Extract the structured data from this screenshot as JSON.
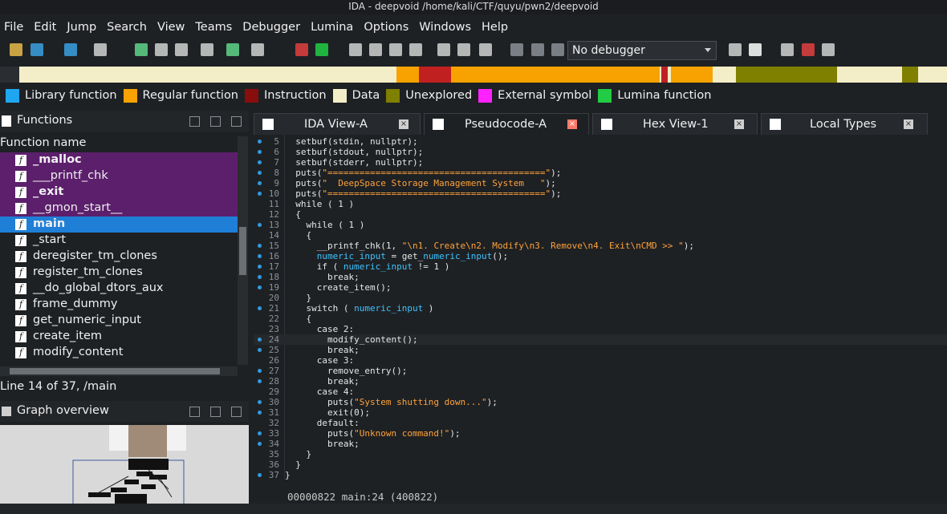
{
  "window": {
    "title": "IDA - deepvoid /home/kali/CTF/quyu/pwn2/deepvoid"
  },
  "menu": [
    "File",
    "Edit",
    "Jump",
    "Search",
    "View",
    "Teams",
    "Debugger",
    "Lumina",
    "Options",
    "Windows",
    "Help"
  ],
  "toolbar": {
    "debugger_select": "No debugger"
  },
  "legend": [
    {
      "label": "Library function",
      "color": "#1ea7f0"
    },
    {
      "label": "Regular function",
      "color": "#f7a200"
    },
    {
      "label": "Instruction",
      "color": "#8a0d0d"
    },
    {
      "label": "Data",
      "color": "#f4eec8"
    },
    {
      "label": "Unexplored",
      "color": "#7f7f00"
    },
    {
      "label": "External symbol",
      "color": "#ff22ff"
    },
    {
      "label": "Lumina function",
      "color": "#22cc44"
    }
  ],
  "functions_panel": {
    "title": "Functions",
    "column_header": "Function name",
    "items": [
      {
        "name": "_malloc",
        "bold": true,
        "highlight": "external"
      },
      {
        "name": "___printf_chk",
        "bold": false,
        "highlight": "external"
      },
      {
        "name": "_exit",
        "bold": true,
        "highlight": "external"
      },
      {
        "name": "__gmon_start__",
        "bold": false,
        "highlight": "external"
      },
      {
        "name": "main",
        "bold": true,
        "highlight": "selected"
      },
      {
        "name": "_start",
        "bold": false,
        "highlight": "none"
      },
      {
        "name": "deregister_tm_clones",
        "bold": false,
        "highlight": "none"
      },
      {
        "name": "register_tm_clones",
        "bold": false,
        "highlight": "none"
      },
      {
        "name": "__do_global_dtors_aux",
        "bold": false,
        "highlight": "none"
      },
      {
        "name": "frame_dummy",
        "bold": false,
        "highlight": "none"
      },
      {
        "name": "get_numeric_input",
        "bold": false,
        "highlight": "none"
      },
      {
        "name": "create_item",
        "bold": false,
        "highlight": "none"
      },
      {
        "name": "modify_content",
        "bold": false,
        "highlight": "none"
      }
    ],
    "status": "Line 14 of 37, /main"
  },
  "graph_panel": {
    "title": "Graph overview"
  },
  "tabs": [
    {
      "label": "IDA View-A",
      "active": false
    },
    {
      "label": "Pseudocode-A",
      "active": true
    },
    {
      "label": "Hex View-1",
      "active": false
    },
    {
      "label": "Local Types",
      "active": false
    }
  ],
  "code": {
    "lines": [
      {
        "n": "5",
        "dot": true,
        "text": "  setbuf(stdin, nullptr);"
      },
      {
        "n": "6",
        "dot": true,
        "text": "  setbuf(stdout, nullptr);"
      },
      {
        "n": "7",
        "dot": true,
        "text": "  setbuf(stderr, nullptr);"
      },
      {
        "n": "8",
        "dot": true,
        "text": "  puts(\"=========================================\");"
      },
      {
        "n": "9",
        "dot": true,
        "text": "  puts(\"  DeepSpace Storage Management System   \");"
      },
      {
        "n": "10",
        "dot": true,
        "text": "  puts(\"=========================================\");"
      },
      {
        "n": "11",
        "dot": false,
        "text": "  while ( 1 )"
      },
      {
        "n": "12",
        "dot": false,
        "text": "  {"
      },
      {
        "n": "13",
        "dot": true,
        "text": "    while ( 1 )"
      },
      {
        "n": "14",
        "dot": false,
        "text": "    {"
      },
      {
        "n": "15",
        "dot": true,
        "text": "      __printf_chk(1, \"\\n1. Create\\n2. Modify\\n3. Remove\\n4. Exit\\nCMD >> \");"
      },
      {
        "n": "16",
        "dot": true,
        "text": "      numeric_input = get_numeric_input();"
      },
      {
        "n": "17",
        "dot": true,
        "text": "      if ( numeric_input != 1 )"
      },
      {
        "n": "18",
        "dot": true,
        "text": "        break;"
      },
      {
        "n": "19",
        "dot": true,
        "text": "      create_item();"
      },
      {
        "n": "20",
        "dot": false,
        "text": "    }"
      },
      {
        "n": "21",
        "dot": true,
        "text": "    switch ( numeric_input )"
      },
      {
        "n": "22",
        "dot": false,
        "text": "    {"
      },
      {
        "n": "23",
        "dot": false,
        "text": "      case 2:"
      },
      {
        "n": "24",
        "dot": true,
        "text": "        modify_content();"
      },
      {
        "n": "25",
        "dot": true,
        "text": "        break;"
      },
      {
        "n": "26",
        "dot": false,
        "text": "      case 3:"
      },
      {
        "n": "27",
        "dot": true,
        "text": "        remove_entry();"
      },
      {
        "n": "28",
        "dot": true,
        "text": "        break;"
      },
      {
        "n": "29",
        "dot": false,
        "text": "      case 4:"
      },
      {
        "n": "30",
        "dot": true,
        "text": "        puts(\"System shutting down...\");"
      },
      {
        "n": "31",
        "dot": true,
        "text": "        exit(0);"
      },
      {
        "n": "32",
        "dot": false,
        "text": "      default:"
      },
      {
        "n": "33",
        "dot": true,
        "text": "        puts(\"Unknown command!\");"
      },
      {
        "n": "34",
        "dot": true,
        "text": "        break;"
      },
      {
        "n": "35",
        "dot": false,
        "text": "    }"
      },
      {
        "n": "36",
        "dot": false,
        "text": "  }"
      },
      {
        "n": "37",
        "dot": true,
        "text": "}"
      }
    ],
    "current_line": "24",
    "status": "00000822 main:24 (400822)"
  }
}
